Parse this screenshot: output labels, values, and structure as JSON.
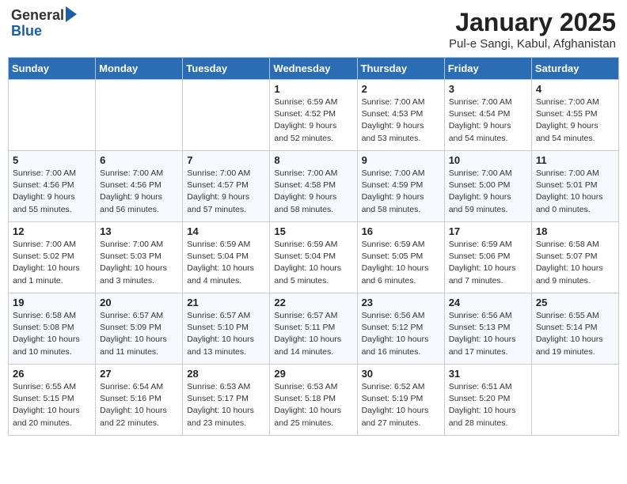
{
  "logo": {
    "general": "General",
    "blue": "Blue"
  },
  "title": "January 2025",
  "subtitle": "Pul-e Sangi, Kabul, Afghanistan",
  "days_of_week": [
    "Sunday",
    "Monday",
    "Tuesday",
    "Wednesday",
    "Thursday",
    "Friday",
    "Saturday"
  ],
  "weeks": [
    [
      {
        "day": "",
        "info": ""
      },
      {
        "day": "",
        "info": ""
      },
      {
        "day": "",
        "info": ""
      },
      {
        "day": "1",
        "info": "Sunrise: 6:59 AM\nSunset: 4:52 PM\nDaylight: 9 hours and 52 minutes."
      },
      {
        "day": "2",
        "info": "Sunrise: 7:00 AM\nSunset: 4:53 PM\nDaylight: 9 hours and 53 minutes."
      },
      {
        "day": "3",
        "info": "Sunrise: 7:00 AM\nSunset: 4:54 PM\nDaylight: 9 hours and 54 minutes."
      },
      {
        "day": "4",
        "info": "Sunrise: 7:00 AM\nSunset: 4:55 PM\nDaylight: 9 hours and 54 minutes."
      }
    ],
    [
      {
        "day": "5",
        "info": "Sunrise: 7:00 AM\nSunset: 4:56 PM\nDaylight: 9 hours and 55 minutes."
      },
      {
        "day": "6",
        "info": "Sunrise: 7:00 AM\nSunset: 4:56 PM\nDaylight: 9 hours and 56 minutes."
      },
      {
        "day": "7",
        "info": "Sunrise: 7:00 AM\nSunset: 4:57 PM\nDaylight: 9 hours and 57 minutes."
      },
      {
        "day": "8",
        "info": "Sunrise: 7:00 AM\nSunset: 4:58 PM\nDaylight: 9 hours and 58 minutes."
      },
      {
        "day": "9",
        "info": "Sunrise: 7:00 AM\nSunset: 4:59 PM\nDaylight: 9 hours and 58 minutes."
      },
      {
        "day": "10",
        "info": "Sunrise: 7:00 AM\nSunset: 5:00 PM\nDaylight: 9 hours and 59 minutes."
      },
      {
        "day": "11",
        "info": "Sunrise: 7:00 AM\nSunset: 5:01 PM\nDaylight: 10 hours and 0 minutes."
      }
    ],
    [
      {
        "day": "12",
        "info": "Sunrise: 7:00 AM\nSunset: 5:02 PM\nDaylight: 10 hours and 1 minute."
      },
      {
        "day": "13",
        "info": "Sunrise: 7:00 AM\nSunset: 5:03 PM\nDaylight: 10 hours and 3 minutes."
      },
      {
        "day": "14",
        "info": "Sunrise: 6:59 AM\nSunset: 5:04 PM\nDaylight: 10 hours and 4 minutes."
      },
      {
        "day": "15",
        "info": "Sunrise: 6:59 AM\nSunset: 5:04 PM\nDaylight: 10 hours and 5 minutes."
      },
      {
        "day": "16",
        "info": "Sunrise: 6:59 AM\nSunset: 5:05 PM\nDaylight: 10 hours and 6 minutes."
      },
      {
        "day": "17",
        "info": "Sunrise: 6:59 AM\nSunset: 5:06 PM\nDaylight: 10 hours and 7 minutes."
      },
      {
        "day": "18",
        "info": "Sunrise: 6:58 AM\nSunset: 5:07 PM\nDaylight: 10 hours and 9 minutes."
      }
    ],
    [
      {
        "day": "19",
        "info": "Sunrise: 6:58 AM\nSunset: 5:08 PM\nDaylight: 10 hours and 10 minutes."
      },
      {
        "day": "20",
        "info": "Sunrise: 6:57 AM\nSunset: 5:09 PM\nDaylight: 10 hours and 11 minutes."
      },
      {
        "day": "21",
        "info": "Sunrise: 6:57 AM\nSunset: 5:10 PM\nDaylight: 10 hours and 13 minutes."
      },
      {
        "day": "22",
        "info": "Sunrise: 6:57 AM\nSunset: 5:11 PM\nDaylight: 10 hours and 14 minutes."
      },
      {
        "day": "23",
        "info": "Sunrise: 6:56 AM\nSunset: 5:12 PM\nDaylight: 10 hours and 16 minutes."
      },
      {
        "day": "24",
        "info": "Sunrise: 6:56 AM\nSunset: 5:13 PM\nDaylight: 10 hours and 17 minutes."
      },
      {
        "day": "25",
        "info": "Sunrise: 6:55 AM\nSunset: 5:14 PM\nDaylight: 10 hours and 19 minutes."
      }
    ],
    [
      {
        "day": "26",
        "info": "Sunrise: 6:55 AM\nSunset: 5:15 PM\nDaylight: 10 hours and 20 minutes."
      },
      {
        "day": "27",
        "info": "Sunrise: 6:54 AM\nSunset: 5:16 PM\nDaylight: 10 hours and 22 minutes."
      },
      {
        "day": "28",
        "info": "Sunrise: 6:53 AM\nSunset: 5:17 PM\nDaylight: 10 hours and 23 minutes."
      },
      {
        "day": "29",
        "info": "Sunrise: 6:53 AM\nSunset: 5:18 PM\nDaylight: 10 hours and 25 minutes."
      },
      {
        "day": "30",
        "info": "Sunrise: 6:52 AM\nSunset: 5:19 PM\nDaylight: 10 hours and 27 minutes."
      },
      {
        "day": "31",
        "info": "Sunrise: 6:51 AM\nSunset: 5:20 PM\nDaylight: 10 hours and 28 minutes."
      },
      {
        "day": "",
        "info": ""
      }
    ]
  ]
}
